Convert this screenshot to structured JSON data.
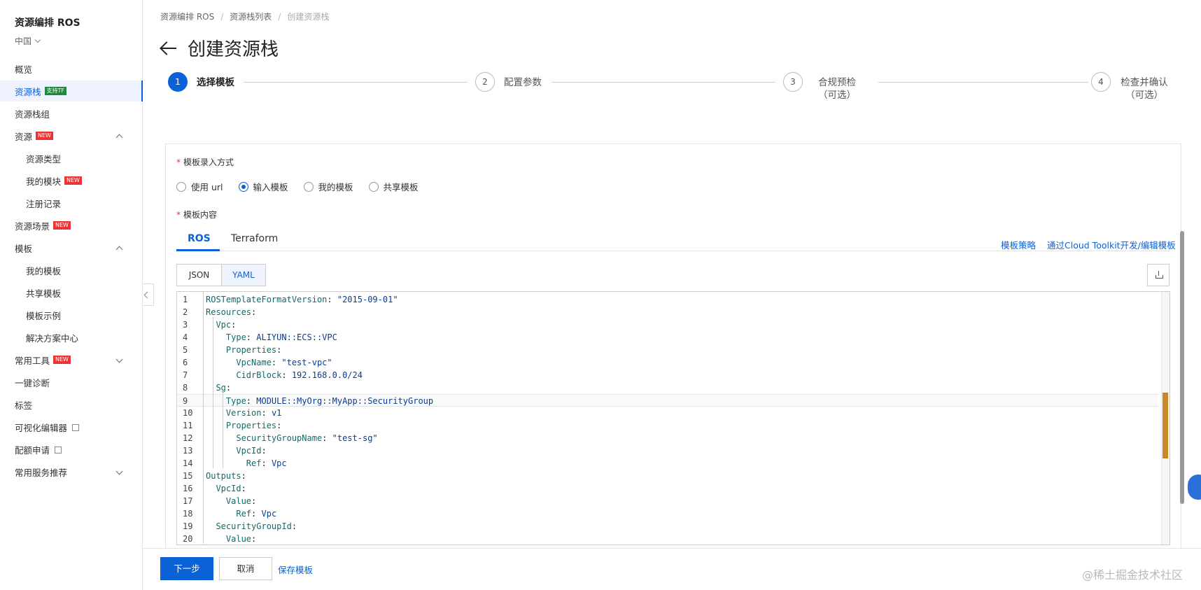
{
  "sidebar": {
    "title": "资源编排 ROS",
    "region": "中国",
    "items": [
      {
        "label": "概览"
      },
      {
        "label": "资源栈",
        "badge": "支持TF"
      },
      {
        "label": "资源栈组"
      },
      {
        "label": "资源",
        "badge": "NEW"
      },
      {
        "label": "资源类型"
      },
      {
        "label": "我的模块",
        "badge": "NEW"
      },
      {
        "label": "注册记录"
      },
      {
        "label": "资源场景",
        "badge": "NEW"
      },
      {
        "label": "模板"
      },
      {
        "label": "我的模板"
      },
      {
        "label": "共享模板"
      },
      {
        "label": "模板示例"
      },
      {
        "label": "解决方案中心"
      },
      {
        "label": "常用工具",
        "badge": "NEW"
      },
      {
        "label": "一键诊断"
      },
      {
        "label": "标签"
      },
      {
        "label": "可视化编辑器"
      },
      {
        "label": "配额申请"
      },
      {
        "label": "常用服务推荐"
      }
    ]
  },
  "breadcrumb": [
    "资源编排 ROS",
    "资源栈列表",
    "创建资源栈"
  ],
  "page_title": "创建资源栈",
  "steps": [
    {
      "num": "1",
      "label": "选择模板"
    },
    {
      "num": "2",
      "label": "配置参数"
    },
    {
      "num": "3",
      "label": "合规预检",
      "sub": "（可选）"
    },
    {
      "num": "4",
      "label": "检查并确认",
      "sub": "（可选）"
    }
  ],
  "form": {
    "input_method_label": "模板录入方式",
    "input_methods": [
      "使用 url",
      "输入模板",
      "我的模板",
      "共享模板"
    ],
    "selected_method": "输入模板",
    "content_label": "模板内容",
    "tabs": [
      "ROS",
      "Terraform"
    ],
    "links": [
      "模板策略",
      "通过Cloud Toolkit开发/编辑模板"
    ],
    "formats": [
      "JSON",
      "YAML"
    ],
    "selected_format": "YAML"
  },
  "code_lines": [
    {
      "n": "1",
      "k": "ROSTemplateFormatVersion",
      "v": "\"2015-09-01\""
    },
    {
      "n": "2",
      "k": "Resources",
      "v": ""
    },
    {
      "n": "3",
      "k": "  Vpc",
      "v": ""
    },
    {
      "n": "4",
      "k": "    Type",
      "v": "ALIYUN::ECS::VPC"
    },
    {
      "n": "5",
      "k": "    Properties",
      "v": ""
    },
    {
      "n": "6",
      "k": "      VpcName",
      "v": "\"test-vpc\""
    },
    {
      "n": "7",
      "k": "      CidrBlock",
      "v": "192.168.0.0/24"
    },
    {
      "n": "8",
      "k": "  Sg",
      "v": ""
    },
    {
      "n": "9",
      "k": "    Type",
      "v": "MODULE::MyOrg::MyApp::SecurityGroup"
    },
    {
      "n": "10",
      "k": "    Version",
      "v": "v1"
    },
    {
      "n": "11",
      "k": "    Properties",
      "v": ""
    },
    {
      "n": "12",
      "k": "      SecurityGroupName",
      "v": "\"test-sg\""
    },
    {
      "n": "13",
      "k": "      VpcId",
      "v": ""
    },
    {
      "n": "14",
      "k": "        Ref",
      "v": "Vpc"
    },
    {
      "n": "15",
      "k": "Outputs",
      "v": ""
    },
    {
      "n": "16",
      "k": "  VpcId",
      "v": ""
    },
    {
      "n": "17",
      "k": "    Value",
      "v": ""
    },
    {
      "n": "18",
      "k": "      Ref",
      "v": "Vpc"
    },
    {
      "n": "19",
      "k": "  SecurityGroupId",
      "v": ""
    },
    {
      "n": "20",
      "k": "    Value",
      "v": ""
    }
  ],
  "footer": {
    "next": "下一步",
    "cancel": "取消",
    "save": "保存模板"
  },
  "watermark": "@稀土掘金技术社区",
  "colors": {
    "accent": "#0b62d6",
    "badge_new": "#e33333",
    "badge_tf": "#1f8b3a"
  }
}
